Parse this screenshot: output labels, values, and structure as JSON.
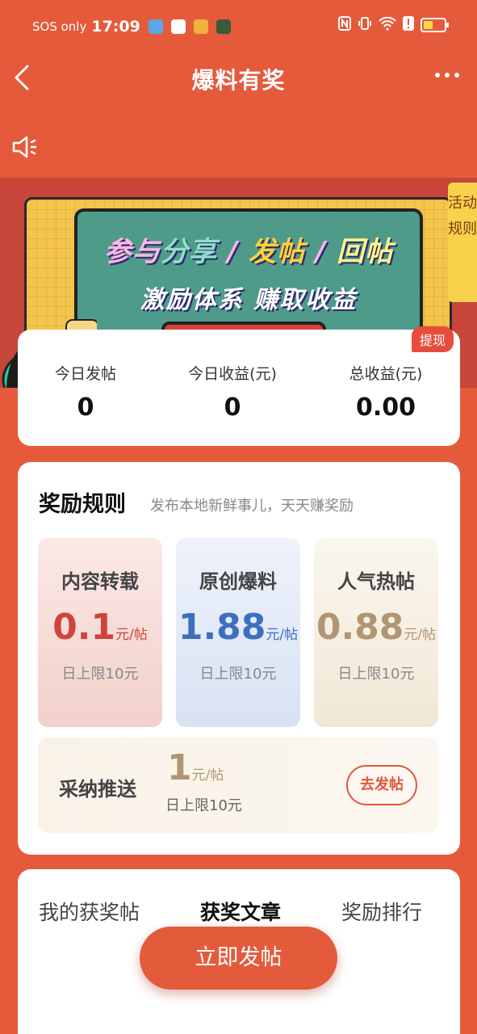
{
  "status_bar": {
    "carrier": "SOS only",
    "time": "17:09",
    "signal_tag": "6",
    "battery_percent": 0.45
  },
  "nav": {
    "back_icon": "chevron-left-icon",
    "title": "爆料有奖",
    "more_icon": "more-dots-icon"
  },
  "banner": {
    "line1_a": "参与",
    "line1_b": "分享",
    "line1_c": " / ",
    "line1_d": "发帖",
    "line1_e": " / ",
    "line1_f": "回帖",
    "line2": "激励体系  赚取收益",
    "rule_tab": "活动规则"
  },
  "stats": {
    "withdraw_label": "提现",
    "items": [
      {
        "label": "今日发帖",
        "value": "0"
      },
      {
        "label": "今日收益(元)",
        "value": "0"
      },
      {
        "label": "总收益(元)",
        "value": "0.00"
      }
    ]
  },
  "rules": {
    "title": "奖励规则",
    "subtitle": "发布本地新鲜事儿，天天赚奖励",
    "tiers": [
      {
        "name": "内容转载",
        "value": "0.1",
        "unit": "元/帖",
        "limit": "日上限10元"
      },
      {
        "name": "原创爆料",
        "value": "1.88",
        "unit": "元/帖",
        "limit": "日上限10元"
      },
      {
        "name": "人气热帖",
        "value": "0.88",
        "unit": "元/帖",
        "limit": "日上限10元"
      }
    ],
    "adopt": {
      "name": "采纳推送",
      "value": "1",
      "unit": "元/帖",
      "limit": "日上限10元",
      "button": "去发帖"
    }
  },
  "tabs": [
    {
      "label": "我的获奖帖",
      "active": false
    },
    {
      "label": "获奖文章",
      "active": true
    },
    {
      "label": "奖励排行",
      "active": false
    }
  ],
  "post_button": "立即发帖",
  "colors": {
    "brand": "#e55a3b",
    "accent_red": "#d0443a",
    "accent_blue": "#3d6fc0",
    "accent_gold": "#b09673"
  }
}
